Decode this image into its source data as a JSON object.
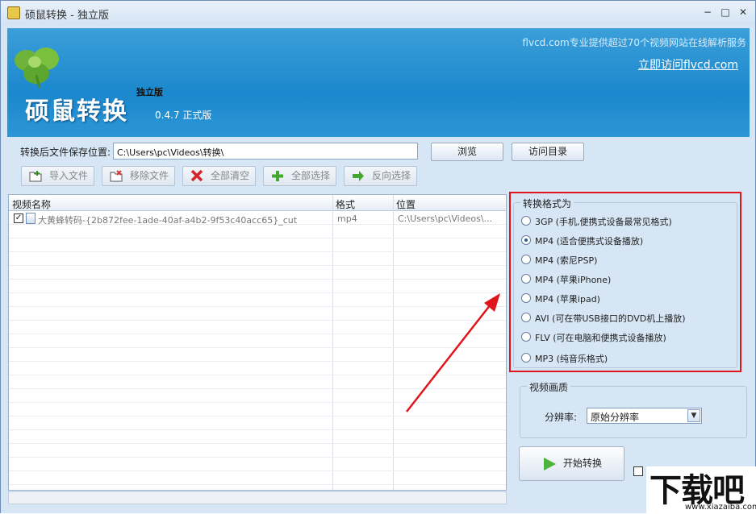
{
  "window": {
    "title": "硕鼠转换 - 独立版",
    "controls": {
      "minimize": "−",
      "maximize": "□",
      "close": "✕"
    }
  },
  "banner": {
    "brand": "硕鼠转换",
    "edition": "独立版",
    "version": "0.4.7 正式版",
    "tagline": "flvcd.com专业提供超过70个视频网站在线解析服务",
    "visit_link": "立即访问flvcd.com"
  },
  "output": {
    "label": "转换后文件保存位置:",
    "path": "C:\\Users\\pc\\Videos\\转换\\",
    "browse": "浏览",
    "open_dir": "访问目录"
  },
  "toolbar": {
    "import": "导入文件",
    "remove": "移除文件",
    "clear_all": "全部清空",
    "select_all": "全部选择",
    "invert": "反向选择"
  },
  "file_list": {
    "columns": [
      "视频名称",
      "格式",
      "位置"
    ],
    "rows": [
      {
        "checked": true,
        "name": "大黄蜂转码-{2b872fee-1ade-40af-a4b2-9f53c40acc65}_cut",
        "format": "mp4",
        "location": "C:\\Users\\pc\\Videos\\..."
      }
    ]
  },
  "format_group": {
    "title": "转换格式为",
    "options": [
      {
        "label": "3GP (手机,便携式设备最常见格式)",
        "selected": false
      },
      {
        "label": "MP4 (适合便携式设备播放)",
        "selected": true
      },
      {
        "label": "MP4 (索尼PSP)",
        "selected": false
      },
      {
        "label": "MP4 (苹果iPhone)",
        "selected": false
      },
      {
        "label": "MP4 (苹果ipad)",
        "selected": false
      },
      {
        "label": "AVI (可在带USB接口的DVD机上播放)",
        "selected": false
      },
      {
        "label": "FLV (可在电脑和便携式设备播放)",
        "selected": false
      },
      {
        "label": "MP3 (纯音乐格式)",
        "selected": false
      }
    ]
  },
  "quality_group": {
    "title": "视频画质",
    "resolution_label": "分辨率:",
    "resolution_value": "原始分辨率"
  },
  "start_button": "开始转换",
  "watermark": {
    "big": "下载吧",
    "small": "www.xiazaiba.com"
  },
  "colors": {
    "banner": "#1b88cd",
    "highlight_box": "#e0151b",
    "arrow": "#e0151b",
    "play": "#4db33b"
  }
}
